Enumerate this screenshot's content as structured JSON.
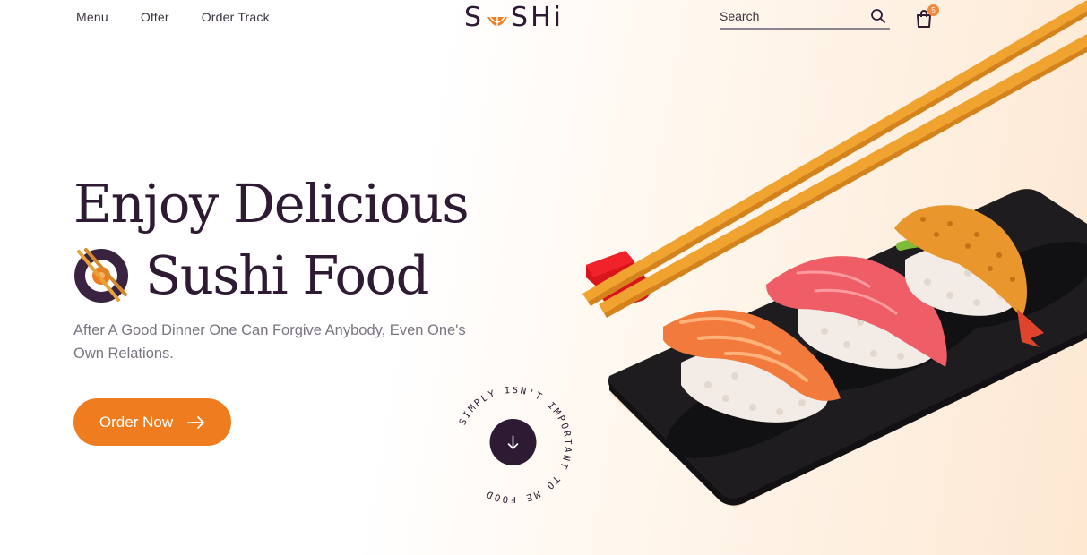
{
  "nav": {
    "items": [
      "Menu",
      "Offer",
      "Order Track"
    ]
  },
  "logo": {
    "left": "S",
    "right": "SHi"
  },
  "search": {
    "placeholder": "Search"
  },
  "cart": {
    "count": "5"
  },
  "hero": {
    "title_line1": "Enjoy Delicious",
    "title_line2": "Sushi Food",
    "subtitle": "After A Good Dinner One Can Forgive Anybody, Even One's Own Relations.",
    "cta_label": "Order Now",
    "circle_text": "SIMPLY ISN'T IMPORTANT TO ME FOOD"
  },
  "colors": {
    "accent": "#ef7c1e",
    "dark": "#2e1b33",
    "muted": "#7a7480"
  },
  "icons": [
    "search-icon",
    "cart-icon",
    "arrow-right-icon",
    "arrow-down-icon",
    "sushi-roll-icon"
  ]
}
